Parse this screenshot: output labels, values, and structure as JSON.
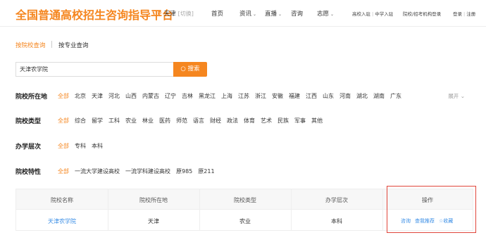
{
  "header": {
    "logo": "全国普通高校招生咨询指导平台",
    "city": "天津",
    "switch_label": "[切换]",
    "nav": [
      {
        "label": "首页",
        "caret": false
      },
      {
        "label": "资讯",
        "caret": true
      },
      {
        "label": "直播",
        "caret": true
      },
      {
        "label": "咨询",
        "caret": false
      },
      {
        "label": "志愿",
        "caret": true
      }
    ],
    "links": {
      "college_login": "高校入驻",
      "middle_school_login": "中学入驻",
      "institution_login": "院校/招考机构登录",
      "login": "登录",
      "register": "注册"
    }
  },
  "tabs": [
    {
      "label": "按院校查询",
      "active": true
    },
    {
      "label": "按专业查询",
      "active": false
    }
  ],
  "search": {
    "value": "天津农学院",
    "button_label": "搜索"
  },
  "filters": [
    {
      "label": "院校所在地",
      "options": [
        "全部",
        "北京",
        "天津",
        "河北",
        "山西",
        "内蒙古",
        "辽宁",
        "吉林",
        "黑龙江",
        "上海",
        "江苏",
        "浙江",
        "安徽",
        "福建",
        "江西",
        "山东",
        "河南",
        "湖北",
        "湖南",
        "广东"
      ],
      "more": "展开"
    },
    {
      "label": "院校类型",
      "options": [
        "全部",
        "综合",
        "留学",
        "工科",
        "农业",
        "林业",
        "医药",
        "师范",
        "语言",
        "财经",
        "政法",
        "体育",
        "艺术",
        "民族",
        "军事",
        "其他"
      ]
    },
    {
      "label": "办学层次",
      "options": [
        "全部",
        "专科",
        "本科"
      ]
    },
    {
      "label": "院校特性",
      "options": [
        "全部",
        "一流大学建设高校",
        "一流学科建设高校",
        "原985",
        "原211"
      ]
    }
  ],
  "table": {
    "headers": [
      "院校名称",
      "院校所在地",
      "院校类型",
      "办学层次",
      "操作"
    ],
    "rows": [
      {
        "name": "天津农学院",
        "location": "天津",
        "type": "农业",
        "level": "本科",
        "actions": [
          "咨询",
          "查我推荐",
          "☆收藏"
        ]
      }
    ]
  },
  "colors": {
    "accent": "#f5861f",
    "link": "#3a8ee6",
    "highlight_border": "#e0453a"
  }
}
